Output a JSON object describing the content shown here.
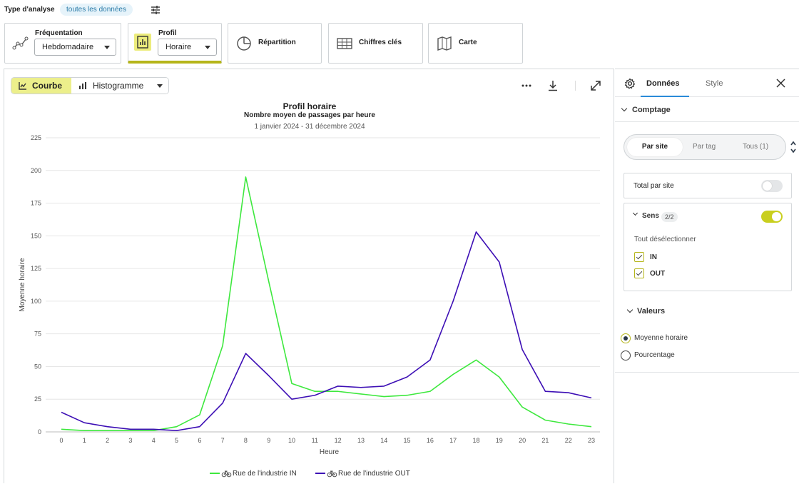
{
  "header": {
    "label": "Type d'analyse",
    "filter_pill": "toutes les données"
  },
  "cards": [
    {
      "title": "Fréquentation",
      "dropdown": "Hebdomadaire",
      "icon": "line-trend-icon"
    },
    {
      "title": "Profil",
      "dropdown": "Horaire",
      "icon": "bar-profile-icon",
      "active": true
    },
    {
      "title": "Répartition",
      "icon": "pie-icon"
    },
    {
      "title": "Chiffres clés",
      "icon": "table-icon"
    },
    {
      "title": "Carte",
      "icon": "map-icon"
    }
  ],
  "chart_toolbar": {
    "curve_label": "Courbe",
    "histogram_label": "Histogramme"
  },
  "chart_data": {
    "type": "line",
    "title": "Profil horaire",
    "subtitle": "Nombre moyen de passages par heure",
    "date_range": "1 janvier 2024 - 31 décembre 2024",
    "xlabel": "Heure",
    "ylabel": "Moyenne horaire",
    "ylim": [
      0,
      225
    ],
    "yticks": [
      0,
      25,
      50,
      75,
      100,
      125,
      150,
      175,
      200,
      225
    ],
    "x": [
      0,
      1,
      2,
      3,
      4,
      5,
      6,
      7,
      8,
      9,
      10,
      11,
      12,
      13,
      14,
      15,
      16,
      17,
      18,
      19,
      20,
      21,
      22,
      23
    ],
    "grid": true,
    "legend_position": "bottom",
    "series": [
      {
        "name": "Rue de l'industrie IN",
        "color": "#3ee83e",
        "values": [
          2,
          1,
          1,
          1,
          1,
          4,
          13,
          66,
          195,
          115,
          37,
          31,
          31,
          29,
          27,
          28,
          31,
          44,
          55,
          42,
          19,
          9,
          6,
          4
        ]
      },
      {
        "name": "Rue de l'industrie OUT",
        "color": "#3d0fb5",
        "values": [
          15,
          7,
          4,
          2,
          2,
          1,
          4,
          22,
          60,
          43,
          25,
          28,
          35,
          34,
          35,
          42,
          55,
          100,
          153,
          130,
          63,
          31,
          30,
          26
        ]
      }
    ]
  },
  "side": {
    "tab_data": "Données",
    "tab_style": "Style",
    "section_comptage": "Comptage",
    "seg_options": [
      "Par site",
      "Par tag",
      "Tous (1)"
    ],
    "total_par_site": "Total par site",
    "sens_label": "Sens",
    "sens_count": "2/2",
    "deselect_all": "Tout désélectionner",
    "checks": [
      "IN",
      "OUT"
    ],
    "section_valeurs": "Valeurs",
    "radios": [
      "Moyenne horaire",
      "Pourcentage"
    ],
    "accent": "#b5b51a",
    "toggle_on_color": "#c9cf1f"
  }
}
